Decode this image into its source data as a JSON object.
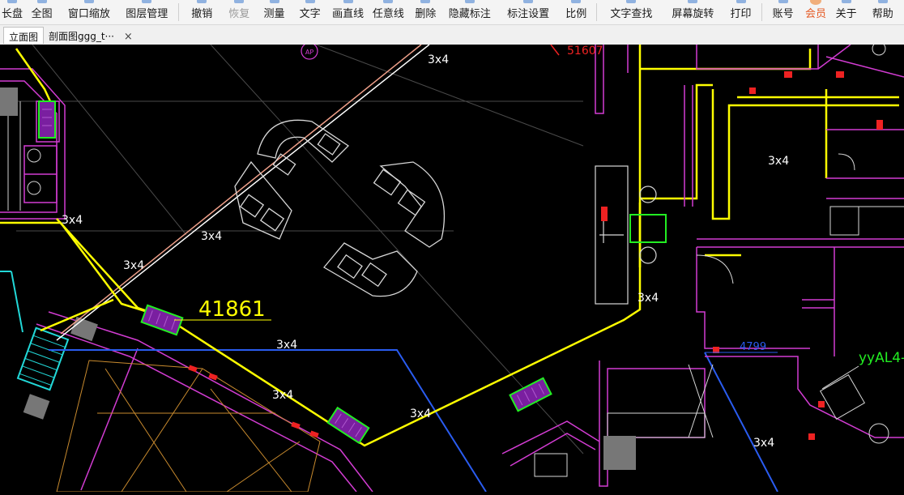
{
  "toolbar": {
    "items": [
      {
        "label": "长盘",
        "state": "normal"
      },
      {
        "label": "全图",
        "state": "normal"
      },
      {
        "label": "窗口缩放",
        "state": "normal"
      },
      {
        "label": "图层管理",
        "state": "normal"
      },
      {
        "label": "撤销",
        "state": "normal"
      },
      {
        "label": "恢复",
        "state": "disabled"
      },
      {
        "label": "测量",
        "state": "normal"
      },
      {
        "label": "文字",
        "state": "normal"
      },
      {
        "label": "画直线",
        "state": "normal"
      },
      {
        "label": "任意线",
        "state": "normal"
      },
      {
        "label": "删除",
        "state": "normal"
      },
      {
        "label": "隐藏标注",
        "state": "normal"
      },
      {
        "label": "标注设置",
        "state": "normal"
      },
      {
        "label": "比例",
        "state": "normal"
      },
      {
        "label": "文字查找",
        "state": "normal"
      },
      {
        "label": "屏幕旋转",
        "state": "normal"
      },
      {
        "label": "打印",
        "state": "normal"
      },
      {
        "label": "账号",
        "state": "normal"
      },
      {
        "label": "会员",
        "state": "member"
      },
      {
        "label": "关于",
        "state": "normal"
      },
      {
        "label": "帮助",
        "state": "normal"
      }
    ]
  },
  "tabs": [
    {
      "label": "立面图",
      "active": true
    },
    {
      "label": "剖面图ggg_t···",
      "active": false
    }
  ],
  "tab_close_glyph": "×",
  "drawing": {
    "annotations": {
      "dim_large": "41861",
      "dim_small": "4799",
      "layer_label": "yyAL4-",
      "axis_tag": "AP",
      "top_label_fragment": "51607",
      "cable_labels": [
        "3x4",
        "3x4",
        "3x4",
        "3x4",
        "3x4",
        "3x4",
        "3x4",
        "3x4",
        "3x4",
        "3x4"
      ]
    },
    "colors": {
      "background": "#000000",
      "yellow_route": "#ffff00",
      "magenta_walls": "#d23cd2",
      "blue_route": "#2a5cf0",
      "green_symbol": "#22ee22",
      "cyan_element": "#22d8d8",
      "red_marker": "#ee2222",
      "white_lines": "#ffffff",
      "salmon_line": "#f0a08a",
      "orange_hatch": "#c88a2e"
    }
  }
}
